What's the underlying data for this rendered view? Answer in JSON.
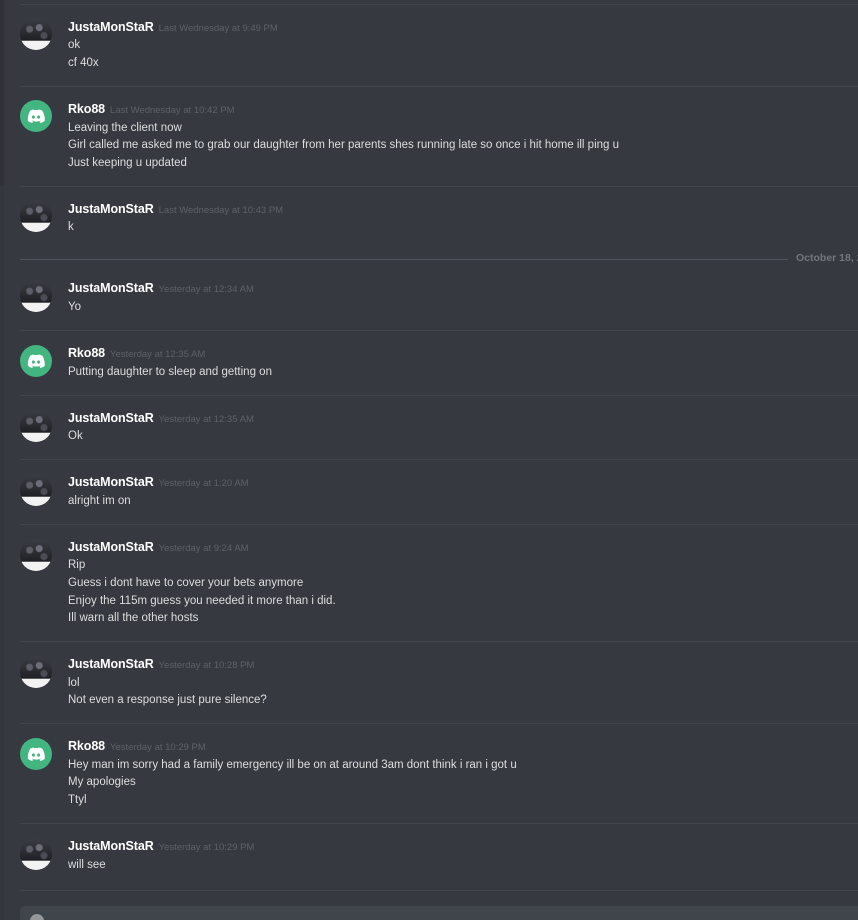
{
  "date_divider": "October 18, 2",
  "messages": [
    {
      "author": "JustaMonStaR",
      "avatar": "photo",
      "timestamp": "Last Wednesday at 9:49 PM",
      "lines": [
        "ok",
        "cf 40x"
      ]
    },
    {
      "author": "Rko88",
      "avatar": "discord",
      "timestamp": "Last Wednesday at 10:42 PM",
      "lines": [
        "Leaving the client now",
        "Girl called me asked me to grab our daughter from her parents shes running late so once i hit home ill ping u",
        "Just keeping u updated"
      ]
    },
    {
      "author": "JustaMonStaR",
      "avatar": "photo",
      "timestamp": "Last Wednesday at 10:43 PM",
      "lines": [
        "k"
      ]
    },
    {
      "author": "JustaMonStaR",
      "avatar": "photo",
      "timestamp": "Yesterday at 12:34 AM",
      "lines": [
        "Yo"
      ]
    },
    {
      "author": "Rko88",
      "avatar": "discord",
      "timestamp": "Yesterday at 12:35 AM",
      "lines": [
        "Putting daughter to sleep and getting on"
      ]
    },
    {
      "author": "JustaMonStaR",
      "avatar": "photo",
      "timestamp": "Yesterday at 12:35 AM",
      "lines": [
        "Ok"
      ]
    },
    {
      "author": "JustaMonStaR",
      "avatar": "photo",
      "timestamp": "Yesterday at 1:20 AM",
      "lines": [
        "alright im on"
      ]
    },
    {
      "author": "JustaMonStaR",
      "avatar": "photo",
      "timestamp": "Yesterday at 9:24 AM",
      "lines": [
        "Rip",
        "Guess i dont have to cover your bets anymore",
        "Enjoy the 115m guess you needed it more than i did.",
        "Ill warn all the other hosts"
      ]
    },
    {
      "author": "JustaMonStaR",
      "avatar": "photo",
      "timestamp": "Yesterday at 10:28 PM",
      "lines": [
        "lol",
        "Not even a response just pure silence?"
      ]
    },
    {
      "author": "Rko88",
      "avatar": "discord",
      "timestamp": "Yesterday at 10:29 PM",
      "lines": [
        "Hey man im sorry had a family emergency ill be on at around 3am dont think i ran i got u",
        "My apologies",
        "Ttyl"
      ]
    },
    {
      "author": "JustaMonStaR",
      "avatar": "photo",
      "timestamp": "Yesterday at 10:29 PM",
      "lines": [
        "will see"
      ]
    }
  ],
  "composer": {
    "placeholder": ""
  }
}
